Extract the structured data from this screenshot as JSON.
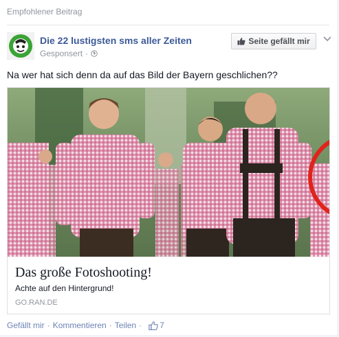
{
  "header": {
    "label": "Empfohlener Beitrag"
  },
  "post": {
    "page_name": "Die 22 lustigsten sms aller Zeiten",
    "sponsored_label": "Gesponsert",
    "sponsored_dot": "·",
    "like_page_label": "Seite gefällt mir",
    "text": "Na wer hat sich denn da auf das Bild der Bayern geschlichen??"
  },
  "link_card": {
    "title": "Das große Fotoshooting!",
    "description": "Achte auf den Hintergrund!",
    "domain": "GO.RAN.DE"
  },
  "actions": {
    "like_label": "Gefällt mir",
    "comment_label": "Kommentieren",
    "share_label": "Teilen",
    "separator": "·",
    "like_count": "7"
  },
  "colors": {
    "link_blue": "#3b5998",
    "meta_gray": "#90949c",
    "highlight_circle": "#e0241c"
  },
  "icons": [
    "page-logo-icon",
    "globe-icon",
    "thumbs-up-icon",
    "chevron-down-icon",
    "like-count-icon"
  ]
}
